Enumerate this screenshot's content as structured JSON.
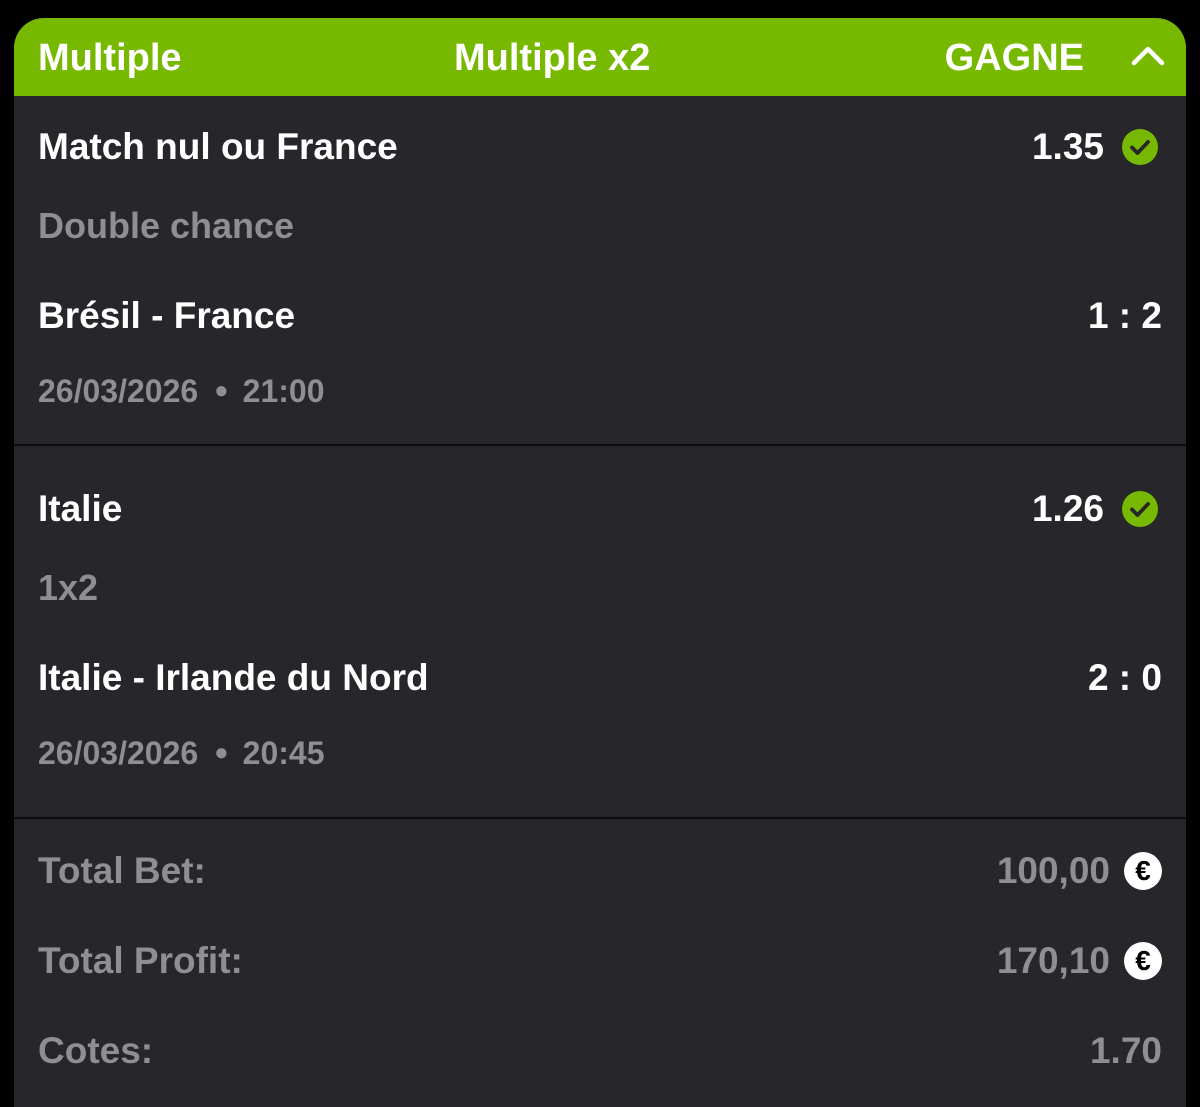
{
  "header": {
    "type_label": "Multiple",
    "bet_label": "Multiple x2",
    "status": "GAGNE",
    "accent_color": "#77b900",
    "toggle_icon": "chevron-up-icon"
  },
  "selections": [
    {
      "pick": "Match nul ou France",
      "odds": "1.35",
      "market": "Double chance",
      "match": "Brésil - France",
      "score": "1 : 2",
      "date": "26/03/2026",
      "time": "21:00",
      "status_icon": "check-circle-icon"
    },
    {
      "pick": "Italie",
      "odds": "1.26",
      "market": "1x2",
      "match": "Italie - Irlande du Nord",
      "score": "2 : 0",
      "date": "26/03/2026",
      "time": "20:45",
      "status_icon": "check-circle-icon"
    }
  ],
  "summary": {
    "total_bet_label": "Total Bet:",
    "total_bet_value": "100,00",
    "total_profit_label": "Total Profit:",
    "total_profit_value": "170,10",
    "odds_label": "Cotes:",
    "odds_value": "1.70",
    "currency_symbol": "€"
  }
}
